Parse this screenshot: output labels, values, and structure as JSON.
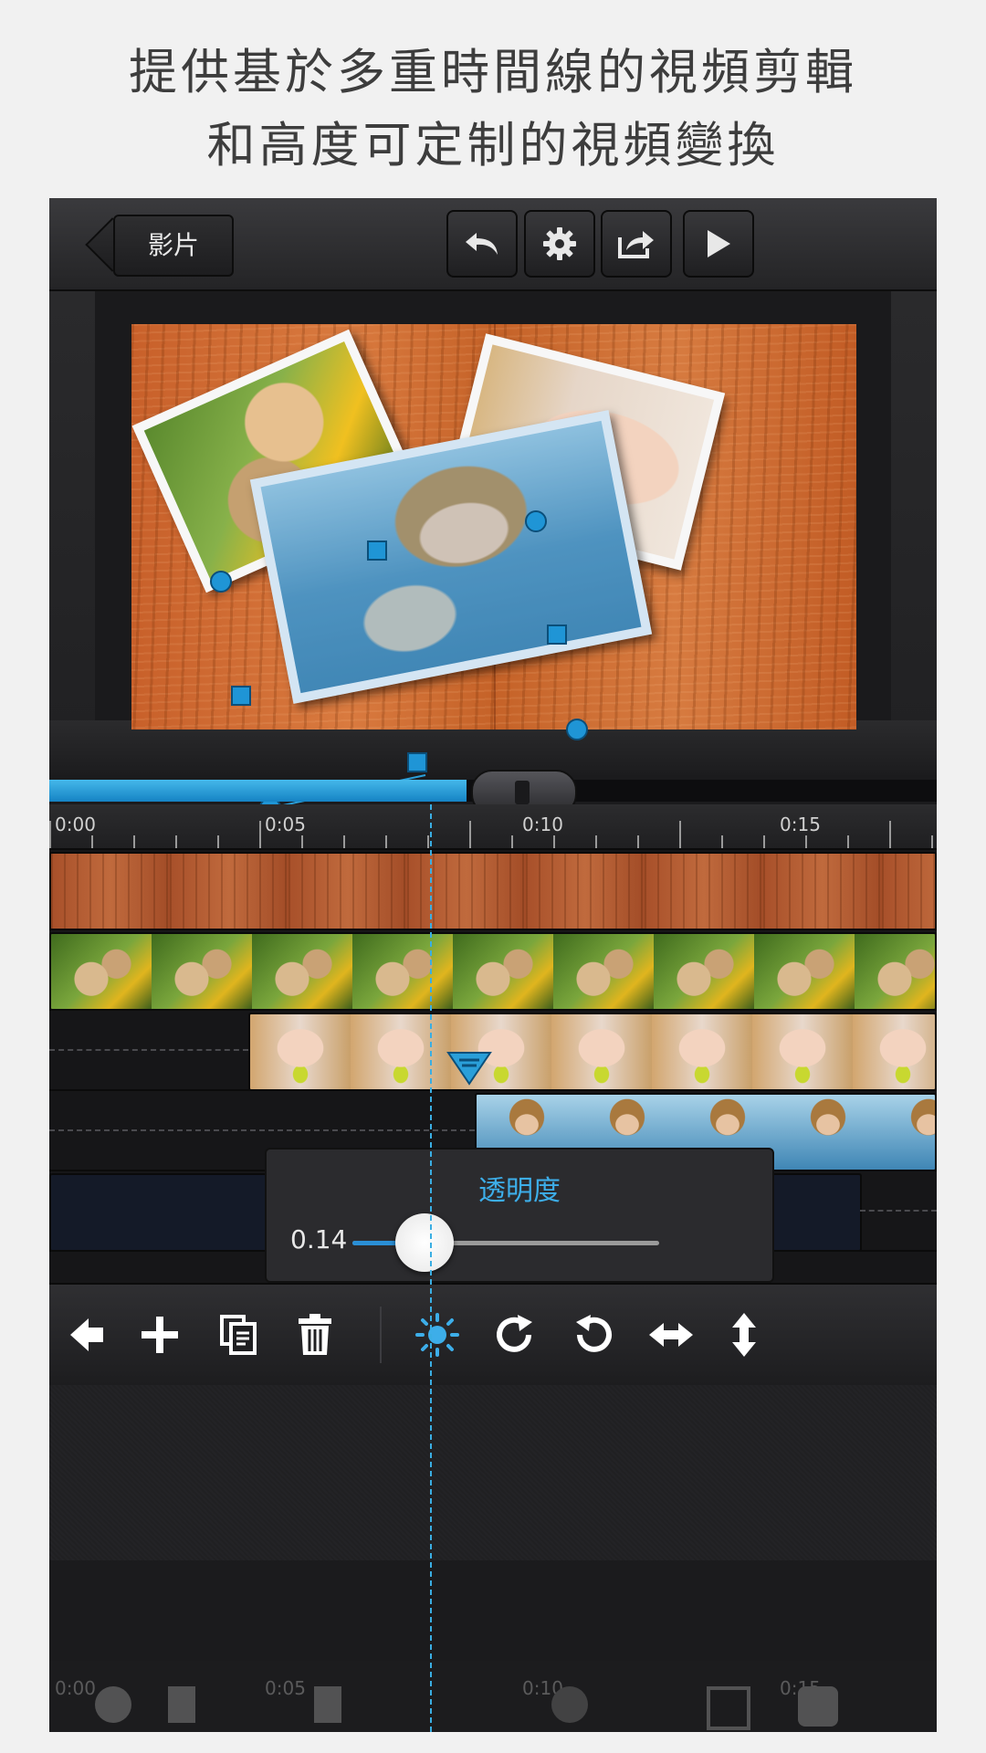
{
  "caption": {
    "line1": "提供基於多重時間線的視頻剪輯",
    "line2": "和高度可定制的視頻變換"
  },
  "nav": {
    "back_label": "影片",
    "buttons": [
      "undo-icon",
      "gear-icon",
      "share-icon",
      "play-icon"
    ]
  },
  "timeline": {
    "progress_fraction": 0.47,
    "ruler_labels": [
      "0:00",
      "0:05",
      "0:10",
      "0:15"
    ]
  },
  "opacity_panel": {
    "title": "透明度",
    "value": "0.14",
    "slider_fraction": 0.14
  },
  "toolbar": {
    "icons": [
      "back-arrow-icon",
      "plus-icon",
      "copy-icon",
      "trash-icon",
      "brightness-icon",
      "rotate-right-icon",
      "rotate-left-icon",
      "flip-horizontal-icon",
      "flip-vertical-icon"
    ],
    "accent": "#3daee9"
  },
  "ghost_toolbar": {
    "ruler_labels": [
      "0:00",
      "0:05",
      "0:10",
      "0:15"
    ]
  },
  "colors": {
    "accent": "#3daee9",
    "progress": "#1f95d6",
    "wood": "#d0703a"
  }
}
